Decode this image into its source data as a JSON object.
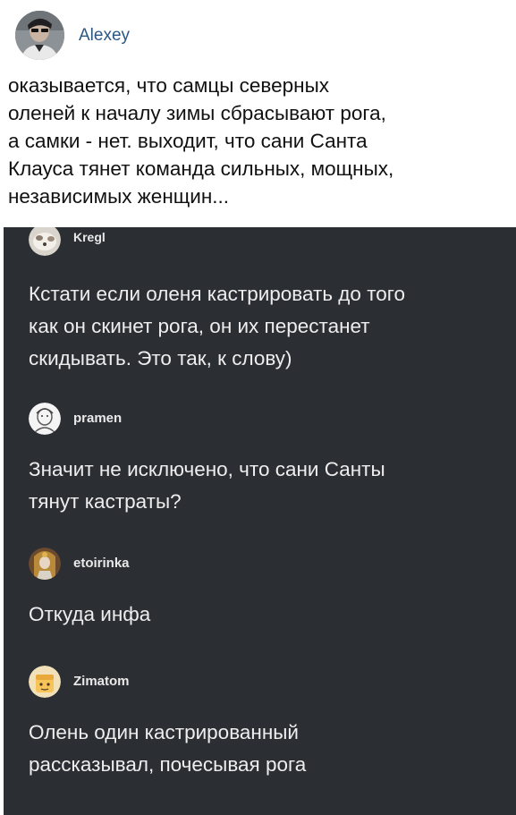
{
  "post": {
    "author": "Alexey",
    "text": "оказывается, что самцы северных\nоленей к началу зимы сбрасывают рога,\nа самки - нет. выходит, что сани Санта\nКлауса тянет команда сильных, мощных,\nнезависимых женщин..."
  },
  "replies": [
    {
      "username": "Kregl",
      "avatar_icon": "fluffy-pet-avatar-icon",
      "text": "Кстати если оленя кастрировать до того\nкак он скинет рога, он их перестанет\nскидывать. Это так, к слову)"
    },
    {
      "username": "pramen",
      "avatar_icon": "sketch-portrait-avatar-icon",
      "text": "Значит не исключено, что сани Санты\nтянут кастраты?"
    },
    {
      "username": "etoirinka",
      "avatar_icon": "ornate-figure-avatar-icon",
      "text": "Откуда инфа"
    },
    {
      "username": "Zimatom",
      "avatar_icon": "cartoon-avatar-icon",
      "text": "Олень один кастрированный\nрассказывал, почесывая рога"
    }
  ],
  "colors": {
    "vk_link": "#2a5885",
    "thread_background": "#2b2e33",
    "thread_text": "#eeeeee"
  }
}
